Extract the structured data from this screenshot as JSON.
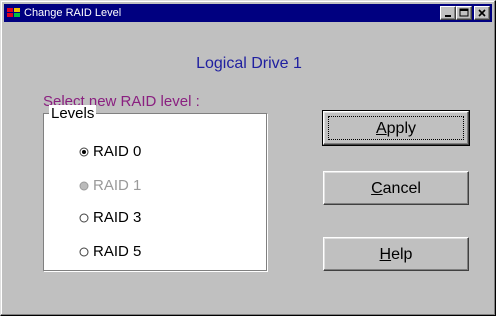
{
  "window": {
    "title": "Change RAID Level",
    "minimize_icon": "minimize-icon",
    "maximize_icon": "maximize-icon",
    "close_icon": "close-icon"
  },
  "heading": "Logical Drive 1",
  "prompt": "Select new RAID level :",
  "levels": {
    "legend": "Levels",
    "options": [
      {
        "label": "RAID 0",
        "selected": true,
        "enabled": true
      },
      {
        "label": "RAID 1",
        "selected": false,
        "enabled": false
      },
      {
        "label": "RAID 3",
        "selected": false,
        "enabled": true
      },
      {
        "label": "RAID 5",
        "selected": false,
        "enabled": true
      }
    ]
  },
  "buttons": {
    "apply": {
      "first": "A",
      "rest": "pply"
    },
    "cancel": {
      "first": "C",
      "rest": "ancel"
    },
    "help": {
      "first": "H",
      "rest": "elp"
    }
  }
}
